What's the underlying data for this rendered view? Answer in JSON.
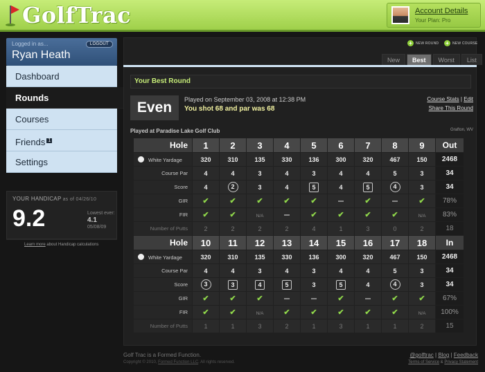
{
  "header": {
    "logo_text": "GolfTrac",
    "account_link": "Account Details",
    "plan": "Your Plan: Pro"
  },
  "sidebar": {
    "logged_in_label": "Logged in as...",
    "logout": "LOGOUT",
    "user_name": "Ryan Heath",
    "nav": [
      {
        "label": "Dashboard"
      },
      {
        "label": "Rounds"
      },
      {
        "label": "Courses"
      },
      {
        "label": "Friends",
        "badge": "1"
      },
      {
        "label": "Settings"
      }
    ],
    "handicap": {
      "label": "YOUR HANDICAP",
      "as_of": "as of 04/26/10",
      "value": "9.2",
      "lowest_label": "Lowest ever:",
      "lowest_value": "4.1",
      "lowest_date": "05/08/09"
    },
    "handicap_link": "Learn more",
    "handicap_link_rest": " about Handicap calculations"
  },
  "actions": {
    "new_round": "NEW ROUND",
    "new_course": "NEW COURSE"
  },
  "tabs": [
    {
      "label": "New"
    },
    {
      "label": "Best"
    },
    {
      "label": "Worst"
    },
    {
      "label": "List"
    }
  ],
  "round": {
    "section_title": "Your Best Round",
    "relative_to_par": "Even",
    "played_on": "Played on September 03, 2008 at 12:38 PM",
    "summary": "You shot 68 and par was 68",
    "course_stats": "Course Stats",
    "edit": "Edit",
    "share": "Share This Round",
    "played_at": "Played at Paradise Lake Golf Club",
    "location": "Grafton, WV"
  },
  "scorecard": {
    "labels": {
      "hole": "Hole",
      "yardage": "White Yardage",
      "par": "Course Par",
      "score": "Score",
      "gir": "GIR",
      "fir": "FIR",
      "putts": "Number of Putts"
    },
    "front": {
      "holes": [
        "1",
        "2",
        "3",
        "4",
        "5",
        "6",
        "7",
        "8",
        "9"
      ],
      "total_label": "Out",
      "yardage": [
        "320",
        "310",
        "135",
        "330",
        "136",
        "300",
        "320",
        "467",
        "150"
      ],
      "yardage_total": "2468",
      "par": [
        "4",
        "4",
        "3",
        "4",
        "3",
        "4",
        "4",
        "5",
        "3"
      ],
      "par_total": "34",
      "score": [
        "4",
        "2",
        "3",
        "4",
        "5",
        "4",
        "5",
        "4",
        "3"
      ],
      "score_marks": [
        "",
        "circle",
        "",
        "",
        "square",
        "",
        "square",
        "circle",
        ""
      ],
      "score_total": "34",
      "gir": [
        "check",
        "check",
        "check",
        "check",
        "check",
        "dash",
        "check",
        "dash",
        "check"
      ],
      "gir_total": "78%",
      "fir": [
        "check",
        "check",
        "N/A",
        "dash",
        "check",
        "check",
        "check",
        "check",
        "N/A"
      ],
      "fir_total": "83%",
      "putts": [
        "2",
        "2",
        "2",
        "2",
        "4",
        "1",
        "3",
        "0",
        "2"
      ],
      "putts_total": "18"
    },
    "back": {
      "holes": [
        "10",
        "11",
        "12",
        "13",
        "14",
        "15",
        "16",
        "17",
        "18"
      ],
      "total_label": "In",
      "yardage": [
        "320",
        "310",
        "135",
        "330",
        "136",
        "300",
        "320",
        "467",
        "150"
      ],
      "yardage_total": "2468",
      "par": [
        "4",
        "4",
        "3",
        "4",
        "3",
        "4",
        "4",
        "5",
        "3"
      ],
      "par_total": "34",
      "score": [
        "3",
        "3",
        "4",
        "5",
        "3",
        "5",
        "4",
        "4",
        "3"
      ],
      "score_marks": [
        "circle",
        "square",
        "square",
        "square",
        "",
        "square",
        "",
        "circle",
        ""
      ],
      "score_total": "34",
      "gir": [
        "check",
        "check",
        "check",
        "dash",
        "dash",
        "check",
        "dash",
        "check",
        "check"
      ],
      "gir_total": "67%",
      "fir": [
        "check",
        "check",
        "N/A",
        "check",
        "check",
        "check",
        "check",
        "check",
        "N/A"
      ],
      "fir_total": "100%",
      "putts": [
        "1",
        "1",
        "3",
        "2",
        "1",
        "3",
        "1",
        "1",
        "2"
      ],
      "putts_total": "15"
    }
  },
  "footer": {
    "tagline": "Golf Trac is a Formed Function.",
    "copyright_prefix": "Copyright © 2010, ",
    "copyright_link": "Formed Function LLC",
    "copyright_suffix": ". All rights reserved.",
    "links": [
      "@golftrac",
      "Blog",
      "Feedback"
    ],
    "legal": [
      "Terms of Service",
      "Privacy Statement"
    ]
  }
}
